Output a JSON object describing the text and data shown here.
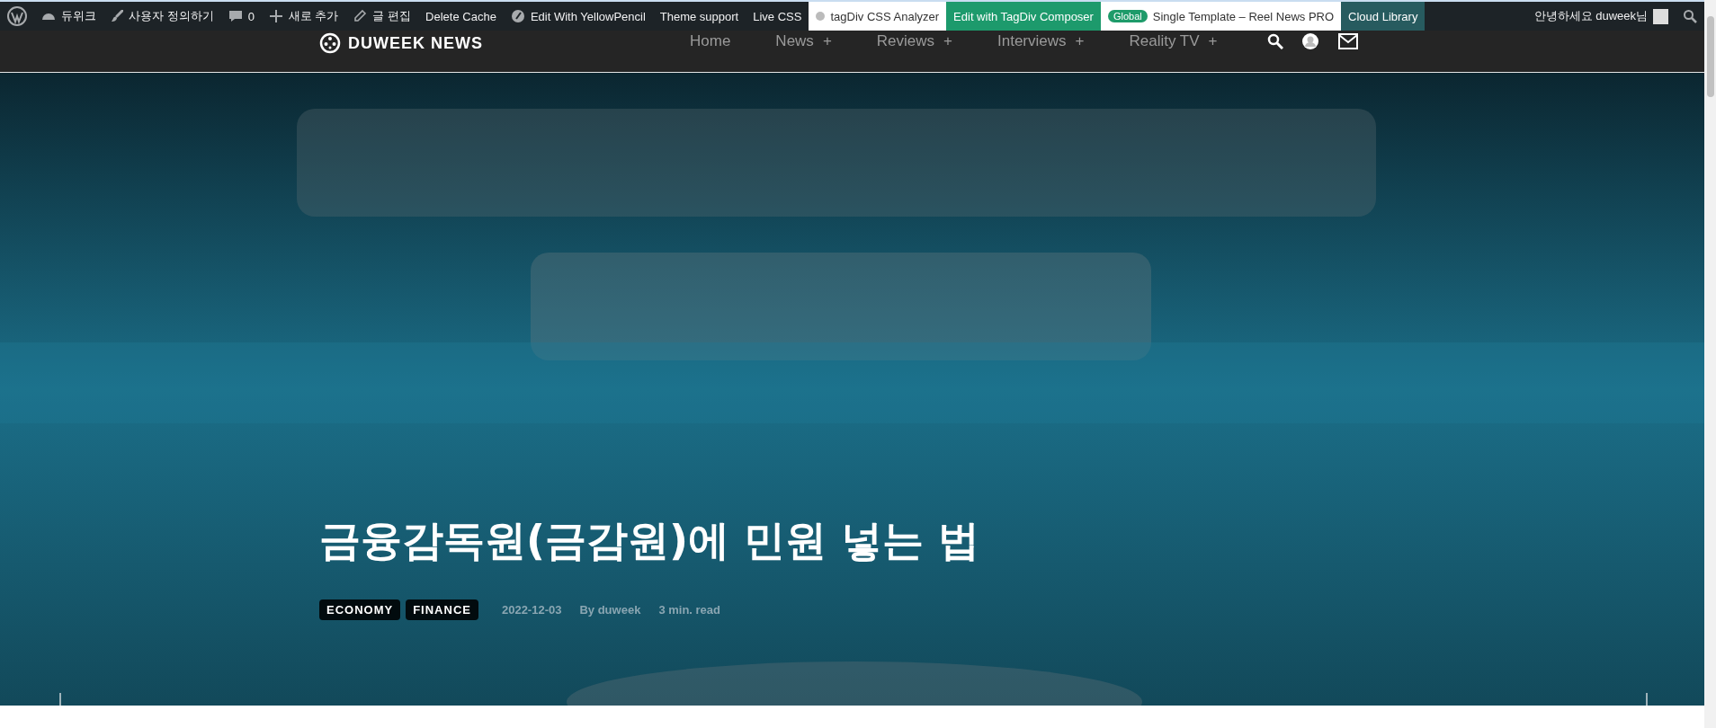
{
  "admin_bar": {
    "left": [
      {
        "kind": "wp"
      },
      {
        "kind": "site",
        "label": "듀위크"
      },
      {
        "kind": "customize",
        "label": "사용자 정의하기"
      },
      {
        "kind": "comments",
        "label": "0"
      },
      {
        "kind": "new",
        "label": "새로 추가"
      },
      {
        "kind": "edit",
        "label": "글 편집"
      },
      {
        "kind": "plain",
        "label": "Delete Cache"
      },
      {
        "kind": "pencil",
        "label": "Edit With YellowPencil"
      },
      {
        "kind": "plain",
        "label": "Theme support"
      },
      {
        "kind": "plain",
        "label": "Live CSS"
      },
      {
        "kind": "analyzer",
        "label": "tagDiv CSS Analyzer"
      },
      {
        "kind": "composer",
        "label": "Edit with TagDiv Composer"
      },
      {
        "kind": "template",
        "badge": "Global",
        "label": "Single Template – Reel News PRO"
      },
      {
        "kind": "library",
        "label": "Cloud Library"
      }
    ],
    "greeting": "안녕하세요 duweek님"
  },
  "header": {
    "logo": "DUWEEK NEWS",
    "nav": [
      {
        "label": "Home"
      },
      {
        "label": "News",
        "plus": "+"
      },
      {
        "label": "Reviews",
        "plus": "+"
      },
      {
        "label": "Interviews",
        "plus": "+"
      },
      {
        "label": "Reality TV",
        "plus": "+"
      }
    ]
  },
  "hero": {
    "title": "금융감독원(금감원)에 민원 넣는 법",
    "tags": [
      "ECONOMY",
      "FINANCE"
    ],
    "date": "2022-12-03",
    "author": "By duweek",
    "read_time": "3 min. read"
  }
}
